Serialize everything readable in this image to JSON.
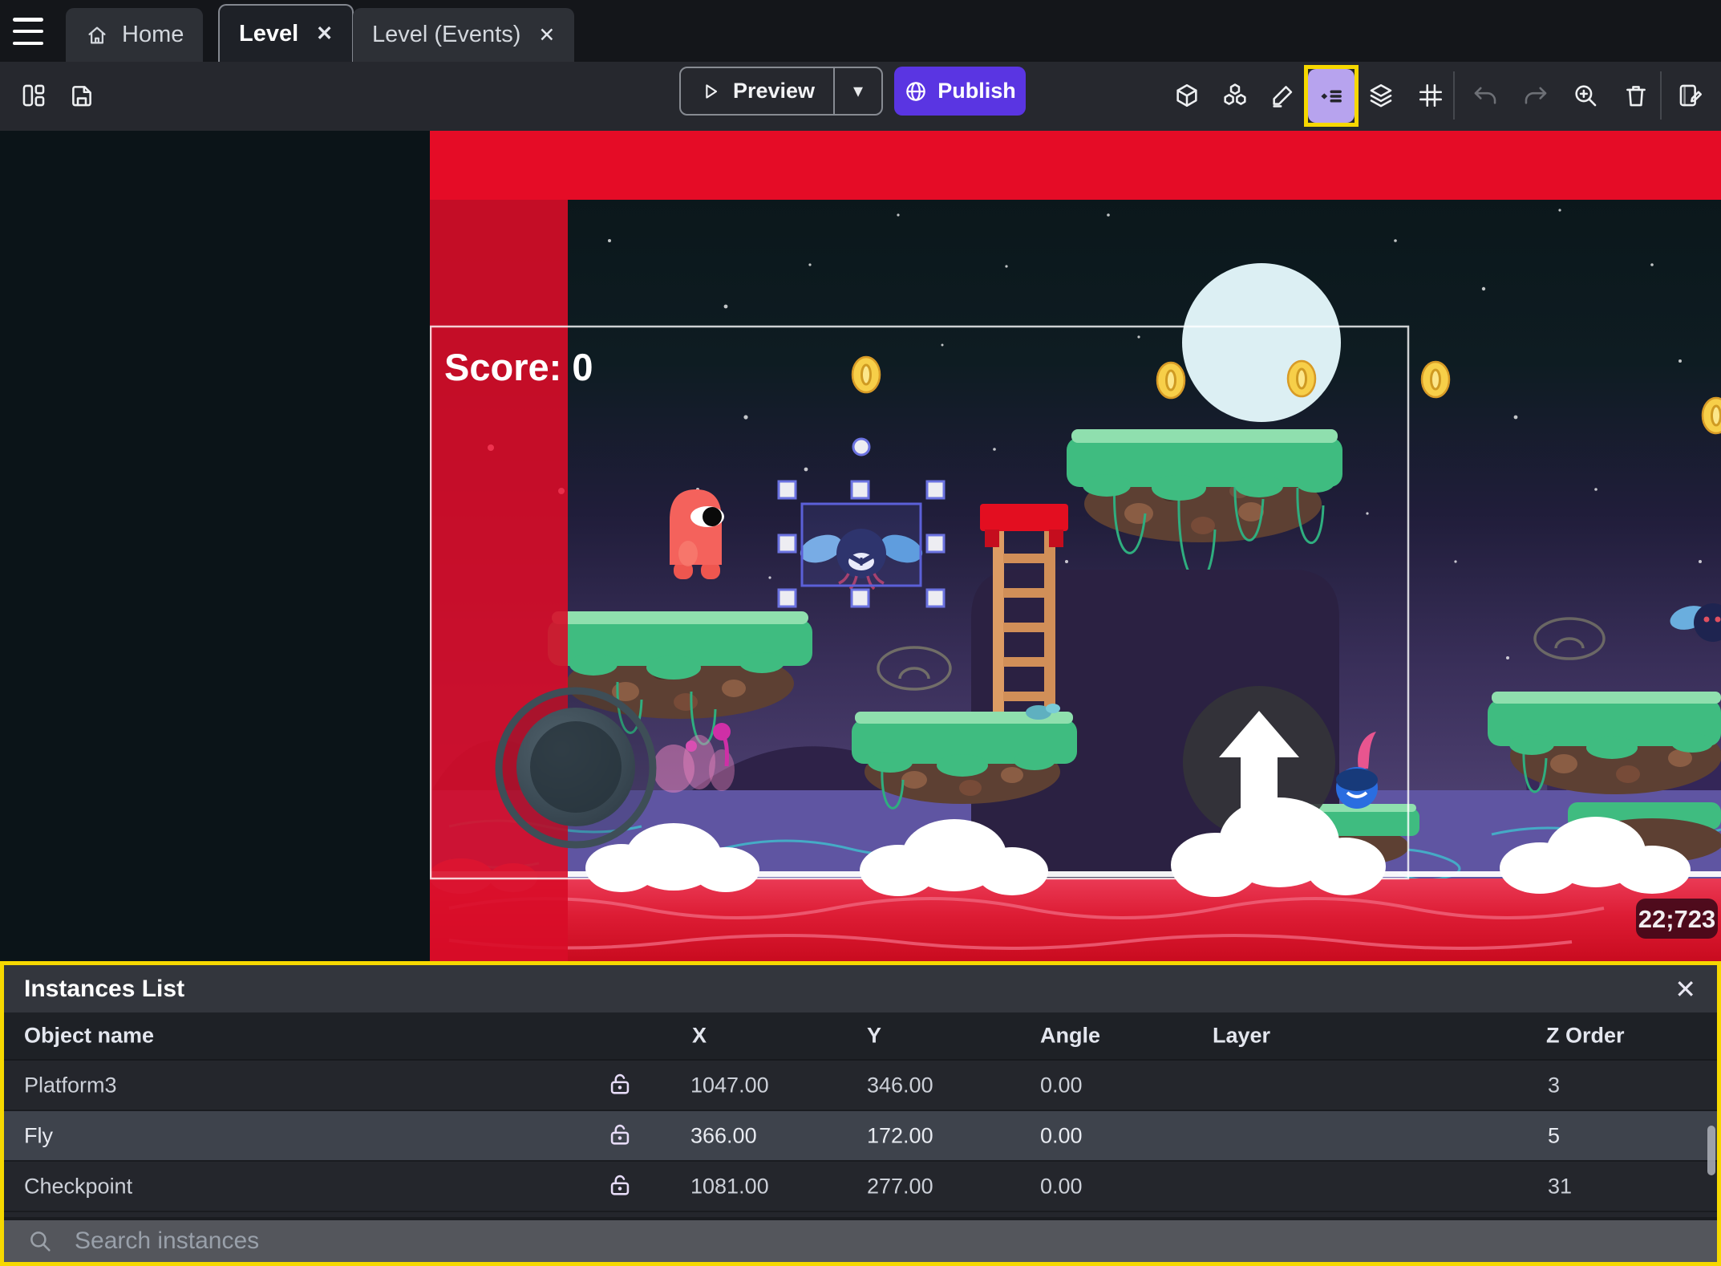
{
  "tabs": {
    "home_label": "Home",
    "level_label": "Level",
    "level_events_label": "Level (Events)"
  },
  "toolbar": {
    "preview_label": "Preview",
    "publish_label": "Publish"
  },
  "icons": {
    "close": "✕",
    "caret_down": "▾"
  },
  "canvas": {
    "score_text": "Score: 0",
    "coords_badge": "22;723"
  },
  "instances_panel": {
    "title": "Instances List",
    "columns": [
      "Object name",
      "X",
      "Y",
      "Angle",
      "Layer",
      "Z Order"
    ],
    "rows": [
      {
        "name": "Platform3",
        "x": "1047.00",
        "y": "346.00",
        "angle": "0.00",
        "layer": "",
        "z_order": "3"
      },
      {
        "name": "Fly",
        "x": "366.00",
        "y": "172.00",
        "angle": "0.00",
        "layer": "",
        "z_order": "5"
      },
      {
        "name": "Checkpoint",
        "x": "1081.00",
        "y": "277.00",
        "angle": "0.00",
        "layer": "",
        "z_order": "31"
      }
    ],
    "search_placeholder": "Search instances"
  },
  "colors": {
    "publish_purple": "#5a35e2",
    "highlight_yellow": "#f6d800",
    "selected_row": "#3e434c",
    "selection_handles": "#6b72e0",
    "red_zone": "#d90f28",
    "panel_bg": "#24262c"
  }
}
